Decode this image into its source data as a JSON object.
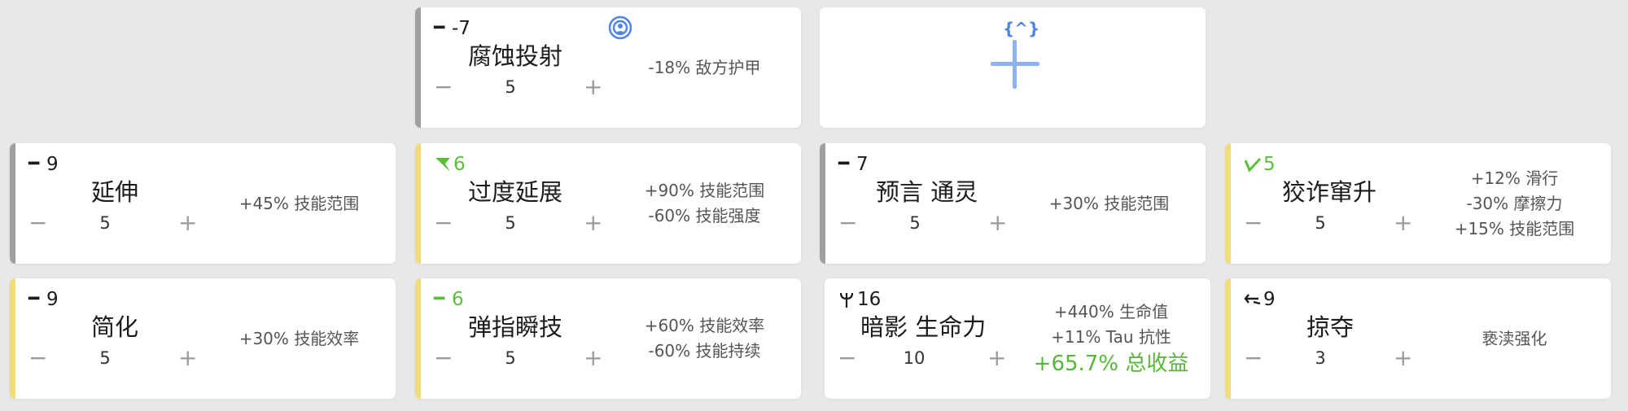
{
  "colors": {
    "bar_gray": "#9ea0a2",
    "bar_yellow": "#f2dc7a",
    "accent_green": "#5bbf3a",
    "icon_blue": "#4f85e6"
  },
  "cards": {
    "decay": {
      "cost": "-7",
      "cost_icon": "bar-icon",
      "name": "腐蚀投射",
      "value": "5",
      "top_icon": "radar-badge-icon",
      "effects": [
        "-18% 敌方护甲"
      ]
    },
    "add": {
      "top_icon": "brace-badge-icon",
      "top_icon_text": "{^}",
      "action": "add-slot"
    },
    "extend": {
      "cost": "9",
      "cost_icon": "bar-icon",
      "name": "延伸",
      "value": "5",
      "effects": [
        "+45% 技能范围"
      ]
    },
    "overextend": {
      "cost": "6",
      "cost_icon": "flag-icon",
      "name": "过度延展",
      "value": "5",
      "effects": [
        "+90% 技能范围",
        "-60% 技能强度"
      ]
    },
    "prophecy": {
      "cost": "7",
      "cost_icon": "bar-icon",
      "name": "预言 通灵",
      "value": "5",
      "effects": [
        "+30% 技能范围"
      ]
    },
    "cunning": {
      "cost": "5",
      "cost_icon": "check-icon",
      "name": "狡诈窜升",
      "value": "5",
      "effects": [
        "+12% 滑行",
        "-30% 摩擦力",
        "+15% 技能范围"
      ]
    },
    "simplify": {
      "cost": "9",
      "cost_icon": "bar-icon",
      "name": "简化",
      "value": "5",
      "effects": [
        "+30% 技能效率"
      ]
    },
    "fingerflick": {
      "cost": "6",
      "cost_icon": "bar-icon",
      "name": "弹指瞬技",
      "value": "5",
      "effects": [
        "+60% 技能效率",
        "-60% 技能持续"
      ]
    },
    "shadowlife": {
      "cost": "16",
      "cost_icon": "trident-icon",
      "name": "暗影 生命力",
      "value": "10",
      "effects": [
        "+440% 生命值",
        "+11% Tau 抗性"
      ],
      "total": "+65.7% 总收益"
    },
    "plunder": {
      "cost": "9",
      "cost_icon": "arrow-icon",
      "name": "掠夺",
      "value": "3",
      "effects": [
        "亵渎强化"
      ]
    }
  },
  "stepper": {
    "minus": "−",
    "plus": "+"
  }
}
